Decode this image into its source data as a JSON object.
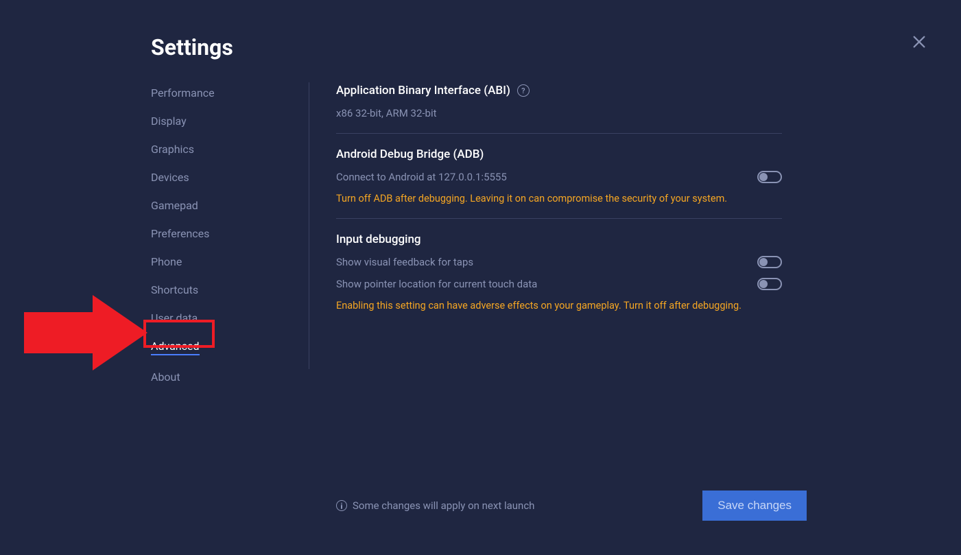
{
  "header": {
    "title": "Settings"
  },
  "sidebar": {
    "items": [
      {
        "label": "Performance",
        "active": false
      },
      {
        "label": "Display",
        "active": false
      },
      {
        "label": "Graphics",
        "active": false
      },
      {
        "label": "Devices",
        "active": false
      },
      {
        "label": "Gamepad",
        "active": false
      },
      {
        "label": "Preferences",
        "active": false
      },
      {
        "label": "Phone",
        "active": false
      },
      {
        "label": "Shortcuts",
        "active": false
      },
      {
        "label": "User data",
        "active": false
      },
      {
        "label": "Advanced",
        "active": true
      },
      {
        "label": "About",
        "active": false
      }
    ]
  },
  "sections": {
    "abi": {
      "title": "Application Binary Interface (ABI)",
      "value": "x86 32-bit, ARM 32-bit"
    },
    "adb": {
      "title": "Android Debug Bridge (ADB)",
      "connect_label": "Connect to Android at 127.0.0.1:5555",
      "connect_on": false,
      "warning": "Turn off ADB after debugging. Leaving it on can compromise the security of your system."
    },
    "input": {
      "title": "Input debugging",
      "taps_label": "Show visual feedback for taps",
      "taps_on": false,
      "pointer_label": "Show pointer location for current touch data",
      "pointer_on": false,
      "warning": "Enabling this setting can have adverse effects on your gameplay. Turn it off after debugging."
    }
  },
  "footer": {
    "note": "Some changes will apply on next launch",
    "save_label": "Save changes"
  }
}
